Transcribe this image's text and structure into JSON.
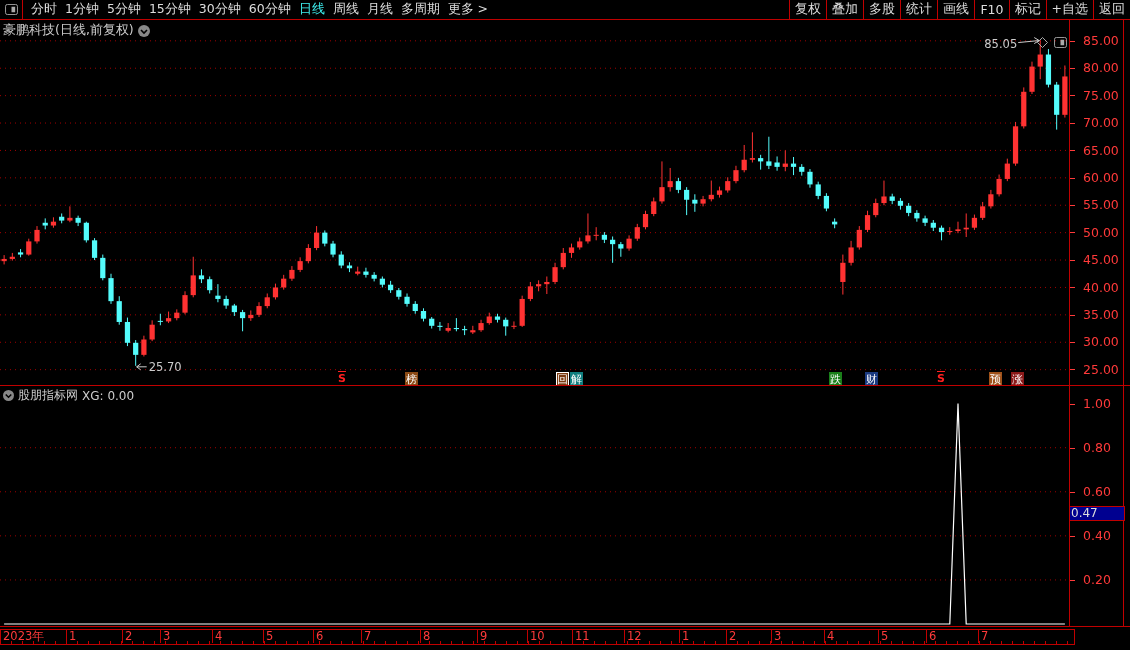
{
  "toolbar": {
    "periods": [
      {
        "label": "分时",
        "selected": false
      },
      {
        "label": "1分钟",
        "selected": false
      },
      {
        "label": "5分钟",
        "selected": false
      },
      {
        "label": "15分钟",
        "selected": false
      },
      {
        "label": "30分钟",
        "selected": false
      },
      {
        "label": "60分钟",
        "selected": false
      },
      {
        "label": "日线",
        "selected": true
      },
      {
        "label": "周线",
        "selected": false
      },
      {
        "label": "月线",
        "selected": false
      },
      {
        "label": "多周期",
        "selected": false
      },
      {
        "label": "更多 >",
        "selected": false
      }
    ],
    "buttons": [
      "复权",
      "叠加",
      "多股",
      "统计",
      "画线",
      "F10",
      "标记",
      "+自选",
      "返回"
    ]
  },
  "price_pane": {
    "title": "豪鹏科技(日线,前复权)",
    "high_label": "85.05",
    "low_label": "25.70",
    "chart_data": {
      "type": "candlestick",
      "grid": true,
      "ylim": [
        22.2,
        88.8
      ],
      "yticks": [
        {
          "value": 85,
          "label": "85.00"
        },
        {
          "value": 80,
          "label": "80.00"
        },
        {
          "value": 75,
          "label": "75.00"
        },
        {
          "value": 70,
          "label": "70.00"
        },
        {
          "value": 65,
          "label": "65.00"
        },
        {
          "value": 60,
          "label": "60.00"
        },
        {
          "value": 55,
          "label": "55.00"
        },
        {
          "value": 50,
          "label": "50.00"
        },
        {
          "value": 45,
          "label": "45.00"
        },
        {
          "value": 40,
          "label": "40.00"
        },
        {
          "value": 35,
          "label": "35.00"
        },
        {
          "value": 30,
          "label": "30.00"
        },
        {
          "value": 25,
          "label": "25.00"
        }
      ],
      "categories": [
        null,
        null,
        null,
        null,
        null,
        null,
        null,
        null,
        null,
        null,
        null,
        null,
        null,
        null,
        null,
        null,
        null,
        null,
        null,
        null,
        null,
        null,
        null,
        null,
        null,
        null,
        null,
        null,
        null,
        null,
        null,
        null,
        null,
        null,
        null,
        null,
        null,
        null,
        null,
        null,
        null,
        null,
        null,
        null,
        null,
        null,
        null,
        null,
        null,
        null,
        null,
        null,
        null,
        null,
        null,
        null,
        null,
        null,
        null,
        null,
        null,
        null,
        null,
        null,
        null,
        null,
        null,
        null,
        null,
        null,
        null,
        null,
        null,
        null,
        null,
        null,
        null,
        null,
        null,
        null,
        null,
        null,
        null,
        null,
        null,
        null,
        null,
        null,
        null,
        null,
        null,
        null,
        null,
        null,
        null,
        null,
        null,
        null,
        null,
        null,
        null,
        null,
        null,
        null,
        null,
        null,
        null,
        null,
        null,
        null,
        null,
        null,
        null,
        null,
        null,
        null,
        null,
        null,
        null,
        null,
        null,
        null,
        null,
        null,
        null,
        null,
        null,
        null,
        null,
        null
      ],
      "ohlc": [
        [
          44.8,
          45.9,
          44.2,
          45.2
        ],
        [
          45.2,
          46.3,
          44.9,
          45.6
        ],
        [
          46.4,
          47.0,
          45.5,
          46.0
        ],
        [
          46.0,
          48.9,
          45.8,
          48.4
        ],
        [
          48.4,
          51.2,
          48.0,
          50.5
        ],
        [
          51.8,
          52.6,
          50.6,
          51.3
        ],
        [
          51.3,
          52.8,
          50.9,
          52.0
        ],
        [
          52.9,
          53.5,
          51.7,
          52.2
        ],
        [
          52.2,
          54.8,
          51.9,
          52.7
        ],
        [
          52.7,
          53.1,
          51.2,
          51.8
        ],
        [
          51.8,
          52.0,
          48.2,
          48.6
        ],
        [
          48.6,
          49.0,
          45.0,
          45.4
        ],
        [
          45.4,
          46.0,
          41.3,
          41.7
        ],
        [
          41.7,
          42.5,
          37.0,
          37.5
        ],
        [
          37.5,
          38.4,
          33.2,
          33.7
        ],
        [
          33.7,
          34.5,
          29.3,
          29.9
        ],
        [
          29.9,
          30.4,
          25.7,
          27.7
        ],
        [
          27.7,
          31.2,
          27.4,
          30.5
        ],
        [
          30.5,
          34.0,
          30.2,
          33.2
        ],
        [
          33.9,
          35.2,
          33.1,
          33.8
        ],
        [
          33.8,
          35.6,
          33.5,
          34.4
        ],
        [
          34.4,
          36.0,
          34.0,
          35.4
        ],
        [
          35.4,
          39.3,
          35.1,
          38.6
        ],
        [
          38.6,
          45.6,
          38.2,
          42.2
        ],
        [
          42.2,
          43.3,
          40.8,
          41.5
        ],
        [
          41.5,
          42.0,
          38.9,
          39.5
        ],
        [
          38.5,
          40.6,
          37.3,
          37.9
        ],
        [
          37.9,
          38.5,
          36.1,
          36.7
        ],
        [
          36.7,
          37.0,
          34.8,
          35.5
        ],
        [
          35.5,
          35.9,
          32.0,
          34.4
        ],
        [
          34.4,
          35.8,
          33.9,
          35.0
        ],
        [
          35.0,
          37.3,
          34.6,
          36.6
        ],
        [
          36.6,
          38.9,
          36.2,
          38.2
        ],
        [
          38.2,
          40.7,
          37.8,
          40.0
        ],
        [
          40.0,
          42.3,
          39.6,
          41.6
        ],
        [
          41.6,
          43.9,
          41.2,
          43.2
        ],
        [
          43.2,
          45.5,
          42.8,
          44.8
        ],
        [
          44.8,
          47.9,
          44.4,
          47.2
        ],
        [
          47.2,
          51.2,
          46.8,
          50.0
        ],
        [
          50.0,
          50.4,
          47.5,
          48.0
        ],
        [
          48.0,
          48.5,
          45.5,
          46.0
        ],
        [
          46.0,
          46.6,
          43.5,
          44.0
        ],
        [
          44.0,
          44.6,
          42.8,
          43.5
        ],
        [
          42.5,
          43.8,
          42.2,
          42.9
        ],
        [
          42.9,
          43.6,
          41.8,
          42.3
        ],
        [
          42.3,
          42.8,
          41.1,
          41.6
        ],
        [
          41.6,
          42.0,
          40.0,
          40.5
        ],
        [
          40.5,
          41.2,
          39.0,
          39.5
        ],
        [
          39.5,
          39.9,
          37.8,
          38.3
        ],
        [
          38.3,
          38.9,
          36.5,
          37.0
        ],
        [
          37.0,
          37.5,
          35.2,
          35.7
        ],
        [
          35.7,
          36.2,
          33.8,
          34.3
        ],
        [
          34.3,
          34.6,
          32.5,
          33.0
        ],
        [
          33.0,
          33.7,
          32.1,
          32.8
        ],
        [
          32.1,
          33.5,
          31.8,
          32.6
        ],
        [
          32.6,
          34.4,
          32.0,
          32.4
        ],
        [
          32.4,
          33.0,
          31.3,
          32.2
        ],
        [
          31.8,
          33.0,
          31.5,
          32.2
        ],
        [
          32.2,
          34.1,
          31.9,
          33.5
        ],
        [
          33.5,
          35.4,
          33.2,
          34.7
        ],
        [
          34.7,
          35.2,
          33.6,
          34.1
        ],
        [
          34.1,
          34.5,
          31.2,
          32.9
        ],
        [
          32.9,
          33.8,
          32.4,
          33.0
        ],
        [
          33.0,
          38.5,
          32.8,
          37.9
        ],
        [
          37.9,
          41.0,
          37.5,
          40.2
        ],
        [
          40.2,
          41.3,
          39.3,
          40.6
        ],
        [
          40.6,
          42.0,
          38.8,
          41.0
        ],
        [
          41.0,
          44.5,
          40.6,
          43.7
        ],
        [
          43.7,
          47.2,
          43.3,
          46.3
        ],
        [
          46.3,
          48.0,
          45.4,
          47.3
        ],
        [
          47.3,
          49.1,
          46.9,
          48.4
        ],
        [
          48.4,
          53.5,
          48.0,
          49.5
        ],
        [
          49.5,
          51.0,
          48.6,
          49.6
        ],
        [
          49.6,
          50.1,
          48.1,
          48.7
        ],
        [
          48.7,
          49.3,
          44.5,
          47.9
        ],
        [
          47.9,
          48.3,
          45.6,
          47.1
        ],
        [
          47.1,
          49.5,
          46.7,
          48.9
        ],
        [
          48.9,
          51.6,
          48.5,
          51.0
        ],
        [
          51.0,
          54.0,
          50.6,
          53.4
        ],
        [
          53.4,
          56.4,
          53.0,
          55.7
        ],
        [
          55.7,
          63.0,
          55.3,
          58.3
        ],
        [
          58.3,
          61.8,
          57.5,
          59.4
        ],
        [
          59.4,
          60.0,
          57.2,
          57.8
        ],
        [
          57.8,
          58.3,
          53.2,
          56.0
        ],
        [
          56.0,
          57.0,
          53.8,
          55.3
        ],
        [
          55.3,
          56.7,
          54.8,
          56.1
        ],
        [
          56.1,
          59.5,
          55.7,
          56.9
        ],
        [
          56.9,
          58.4,
          56.4,
          57.7
        ],
        [
          57.7,
          60.1,
          57.3,
          59.4
        ],
        [
          59.4,
          62.2,
          59.0,
          61.4
        ],
        [
          61.4,
          66.0,
          61.0,
          63.3
        ],
        [
          63.3,
          68.3,
          62.8,
          63.6
        ],
        [
          63.6,
          64.2,
          61.5,
          63.0
        ],
        [
          63.0,
          67.5,
          61.6,
          62.2
        ],
        [
          62.8,
          63.9,
          61.3,
          62.0
        ],
        [
          62.0,
          65.0,
          61.2,
          62.6
        ],
        [
          62.6,
          63.8,
          60.5,
          62.0
        ],
        [
          62.0,
          62.5,
          60.4,
          61.1
        ],
        [
          61.1,
          61.6,
          58.2,
          58.8
        ],
        [
          58.8,
          59.3,
          56.1,
          56.7
        ],
        [
          56.7,
          57.2,
          53.9,
          54.4
        ],
        [
          52.0,
          52.6,
          50.8,
          51.5
        ],
        [
          41.0,
          46.0,
          38.7,
          44.5
        ],
        [
          44.5,
          48.5,
          44.0,
          47.3
        ],
        [
          47.3,
          51.2,
          46.9,
          50.5
        ],
        [
          50.5,
          54.0,
          50.1,
          53.2
        ],
        [
          53.2,
          56.2,
          52.8,
          55.4
        ],
        [
          55.4,
          59.5,
          55.0,
          56.6
        ],
        [
          56.6,
          57.1,
          55.2,
          55.8
        ],
        [
          55.8,
          56.3,
          54.2,
          54.9
        ],
        [
          54.9,
          55.4,
          53.0,
          53.6
        ],
        [
          53.6,
          54.1,
          52.0,
          52.6
        ],
        [
          52.6,
          53.1,
          51.2,
          51.8
        ],
        [
          51.8,
          52.3,
          50.3,
          50.9
        ],
        [
          50.9,
          51.3,
          48.6,
          50.1
        ],
        [
          50.1,
          51.0,
          49.6,
          50.3
        ],
        [
          50.3,
          52.0,
          49.9,
          50.6
        ],
        [
          50.6,
          53.5,
          49.2,
          50.9
        ],
        [
          50.9,
          53.3,
          50.5,
          52.7
        ],
        [
          52.7,
          55.6,
          52.3,
          54.8
        ],
        [
          54.8,
          57.8,
          54.4,
          57.0
        ],
        [
          57.0,
          60.6,
          56.6,
          59.8
        ],
        [
          59.8,
          63.5,
          59.4,
          62.6
        ],
        [
          62.6,
          70.2,
          62.2,
          69.4
        ],
        [
          69.4,
          76.5,
          69.0,
          75.7
        ],
        [
          75.7,
          81.2,
          75.3,
          80.3
        ],
        [
          80.3,
          85.05,
          78.0,
          82.5
        ],
        [
          82.5,
          83.5,
          76.5,
          77.0
        ],
        [
          77.0,
          77.5,
          68.8,
          71.5
        ],
        [
          71.5,
          80.5,
          71.0,
          78.5
        ]
      ]
    },
    "events": [
      {
        "text": "S",
        "kind": "signal",
        "color": "#ff2020"
      },
      {
        "text": "榜",
        "kind": "tag",
        "color": "#8b4a14"
      },
      {
        "text": "回",
        "kind": "outline",
        "color": "#7a3a10"
      },
      {
        "text": "解",
        "kind": "tag",
        "color": "#0f7f7f"
      },
      {
        "text": "跌",
        "kind": "tag",
        "color": "#1a7f1a"
      },
      {
        "text": "财",
        "kind": "tag",
        "color": "#1a3a80"
      },
      {
        "text": "S",
        "kind": "signal",
        "color": "#ff2020"
      },
      {
        "text": "预",
        "kind": "tag",
        "color": "#a0521a"
      },
      {
        "text": "涨",
        "kind": "tag",
        "color": "#8b1a1a"
      }
    ]
  },
  "indicator_pane": {
    "title": "股朋指标网",
    "reading": "XG: 0.00",
    "current_value": "0.47",
    "chart_data": {
      "type": "line",
      "grid": true,
      "ylim": [
        0,
        1.08
      ],
      "yticks": [
        {
          "value": 1,
          "label": "1.00"
        },
        {
          "value": 0.8,
          "label": "0.80"
        },
        {
          "value": 0.6,
          "label": "0.60"
        },
        {
          "value": 0.4,
          "label": "0.40"
        },
        {
          "value": 0.2,
          "label": "0.20"
        }
      ],
      "categories": [
        null,
        null,
        null,
        null,
        null,
        null,
        null,
        null,
        null,
        null,
        null,
        null,
        null,
        null,
        null,
        null,
        null,
        null,
        null,
        null,
        null,
        null,
        null,
        null,
        null,
        null,
        null,
        null,
        null,
        null,
        null,
        null,
        null,
        null,
        null,
        null,
        null,
        null,
        null,
        null,
        null,
        null,
        null,
        null,
        null,
        null,
        null,
        null,
        null,
        null,
        null,
        null,
        null,
        null,
        null,
        null,
        null,
        null,
        null,
        null,
        null,
        null,
        null,
        null,
        null,
        null,
        null,
        null,
        null,
        null,
        null,
        null,
        null,
        null,
        null,
        null,
        null,
        null,
        null,
        null,
        null,
        null,
        null,
        null,
        null,
        null,
        null,
        null,
        null,
        null,
        null,
        null,
        null,
        null,
        null,
        null,
        null,
        null,
        null,
        null,
        null,
        null,
        null,
        null,
        null,
        null,
        null,
        null,
        null,
        null,
        null,
        null,
        null,
        null,
        null,
        null,
        null,
        null,
        null,
        null,
        null,
        null,
        null,
        null,
        null,
        null,
        null,
        null,
        null,
        null
      ],
      "series": [
        {
          "color": "#ffffff",
          "values": [
            0,
            0,
            0,
            0,
            0,
            0,
            0,
            0,
            0,
            0,
            0,
            0,
            0,
            0,
            0,
            0,
            0,
            0,
            0,
            0,
            0,
            0,
            0,
            0,
            0,
            0,
            0,
            0,
            0,
            0,
            0,
            0,
            0,
            0,
            0,
            0,
            0,
            0,
            0,
            0,
            0,
            0,
            0,
            0,
            0,
            0,
            0,
            0,
            0,
            0,
            0,
            0,
            0,
            0,
            0,
            0,
            0,
            0,
            0,
            0,
            0,
            0,
            0,
            0,
            0,
            0,
            0,
            0,
            0,
            0,
            0,
            0,
            0,
            0,
            0,
            0,
            0,
            0,
            0,
            0,
            0,
            0,
            0,
            0,
            0,
            0,
            0,
            0,
            0,
            0,
            0,
            0,
            0,
            0,
            0,
            0,
            0,
            0,
            0,
            0,
            0,
            0,
            0,
            0,
            0,
            0,
            0,
            0,
            0,
            0,
            0,
            0,
            0,
            0,
            0,
            0,
            1,
            0,
            0,
            0,
            0,
            0,
            0,
            0,
            0,
            0,
            0,
            0,
            0,
            0
          ]
        }
      ]
    }
  },
  "date_axis": [
    "2023年",
    "1",
    "2",
    "3",
    "4",
    "5",
    "6",
    "7",
    "8",
    "9",
    "10",
    "11",
    "12",
    "1",
    "2",
    "3",
    "4",
    "5",
    "6",
    "7"
  ]
}
